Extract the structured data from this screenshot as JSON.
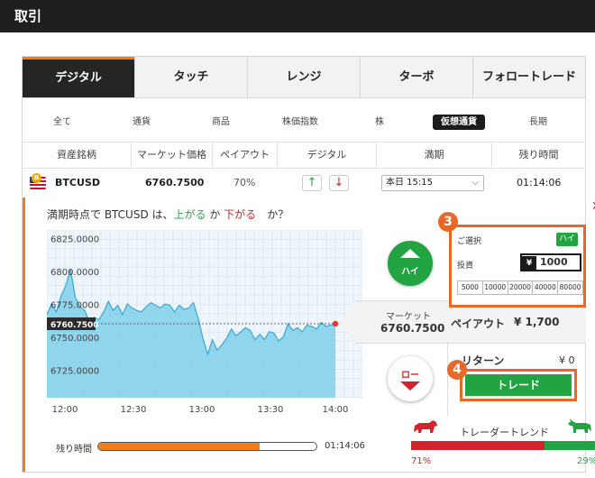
{
  "page": {
    "title": "取引"
  },
  "tabs": [
    "デジタル",
    "タッチ",
    "レンジ",
    "ターボ",
    "フォロートレード"
  ],
  "subtabs": [
    "全て",
    "通貨",
    "商品",
    "株価指数",
    "株",
    "仮想通貨",
    "長期"
  ],
  "columns": [
    "資産銘柄",
    "マーケット価格",
    "ペイアウト",
    "デジタル",
    "満期",
    "残り時間"
  ],
  "row": {
    "coin_symbol": "B",
    "asset": "BTCUSD",
    "price": "6760.7500",
    "payout": "70%",
    "up_arrow": "↑",
    "down_arrow": "↓",
    "expiry": "本日 15:15",
    "expiry_chevron": "⌵",
    "remaining": "01:14:06"
  },
  "question": {
    "prefix": "満期時点で BTCUSD は、",
    "up": "上がる",
    "mid": " か ",
    "down": "下がる",
    "suffix": "　か？"
  },
  "close_symbol": "✕",
  "chart_data": {
    "type": "area",
    "x_ticks": [
      "12:00",
      "12:30",
      "13:00",
      "13:30",
      "14:00"
    ],
    "y_ticks": [
      "6825.0000",
      "6800.0000",
      "6775.0000",
      "6750.0000",
      "6725.0000"
    ],
    "ylim": [
      6705,
      6832
    ],
    "current_label": "6760.7500",
    "values": [
      6768,
      6776,
      6770,
      6782,
      6790,
      6802,
      6781,
      6774,
      6771,
      6762,
      6766,
      6764,
      6770,
      6778,
      6771,
      6775,
      6768,
      6776,
      6773,
      6771,
      6770,
      6774,
      6777,
      6775,
      6773,
      6776,
      6775,
      6770,
      6775,
      6772,
      6773,
      6777,
      6765,
      6750,
      6738,
      6749,
      6741,
      6745,
      6750,
      6757,
      6752,
      6755,
      6758,
      6756,
      6749,
      6753,
      6749,
      6755,
      6754,
      6748,
      6751,
      6761,
      6756,
      6758,
      6755,
      6760,
      6759,
      6757,
      6762,
      6759,
      6760,
      6761
    ],
    "fill_color": "#7fcfe8",
    "line_color": "#3aa8d4",
    "marker_color": "#e53935"
  },
  "progress": {
    "label": "残り時間",
    "fraction": 0.74,
    "time": "01:14:06"
  },
  "buttons": {
    "high": "ハイ",
    "low": "ロー",
    "trade": "トレード"
  },
  "market": {
    "label": "マーケット",
    "value": "6760.7500",
    "payout_label": "ペイアウト",
    "payout_value": "¥ 1,700"
  },
  "return": {
    "label": "リターン",
    "value": "¥ 0"
  },
  "selection": {
    "label": "ご選択",
    "selected": "ハイ",
    "invest_label": "投資",
    "currency": "¥",
    "amount": "1000",
    "presets": [
      "5000",
      "10000",
      "20000",
      "40000",
      "80000"
    ]
  },
  "callouts": [
    "3",
    "4"
  ],
  "trend": {
    "label": "トレーダートレンド",
    "bear_fraction": 0.71,
    "bull_fraction": 0.29,
    "bear_label": "71%",
    "bull_label": "29%"
  },
  "colors": {
    "accent": "#f07d1a",
    "highlight": "#e8682a",
    "green": "#23a443",
    "red": "#d3232c"
  }
}
